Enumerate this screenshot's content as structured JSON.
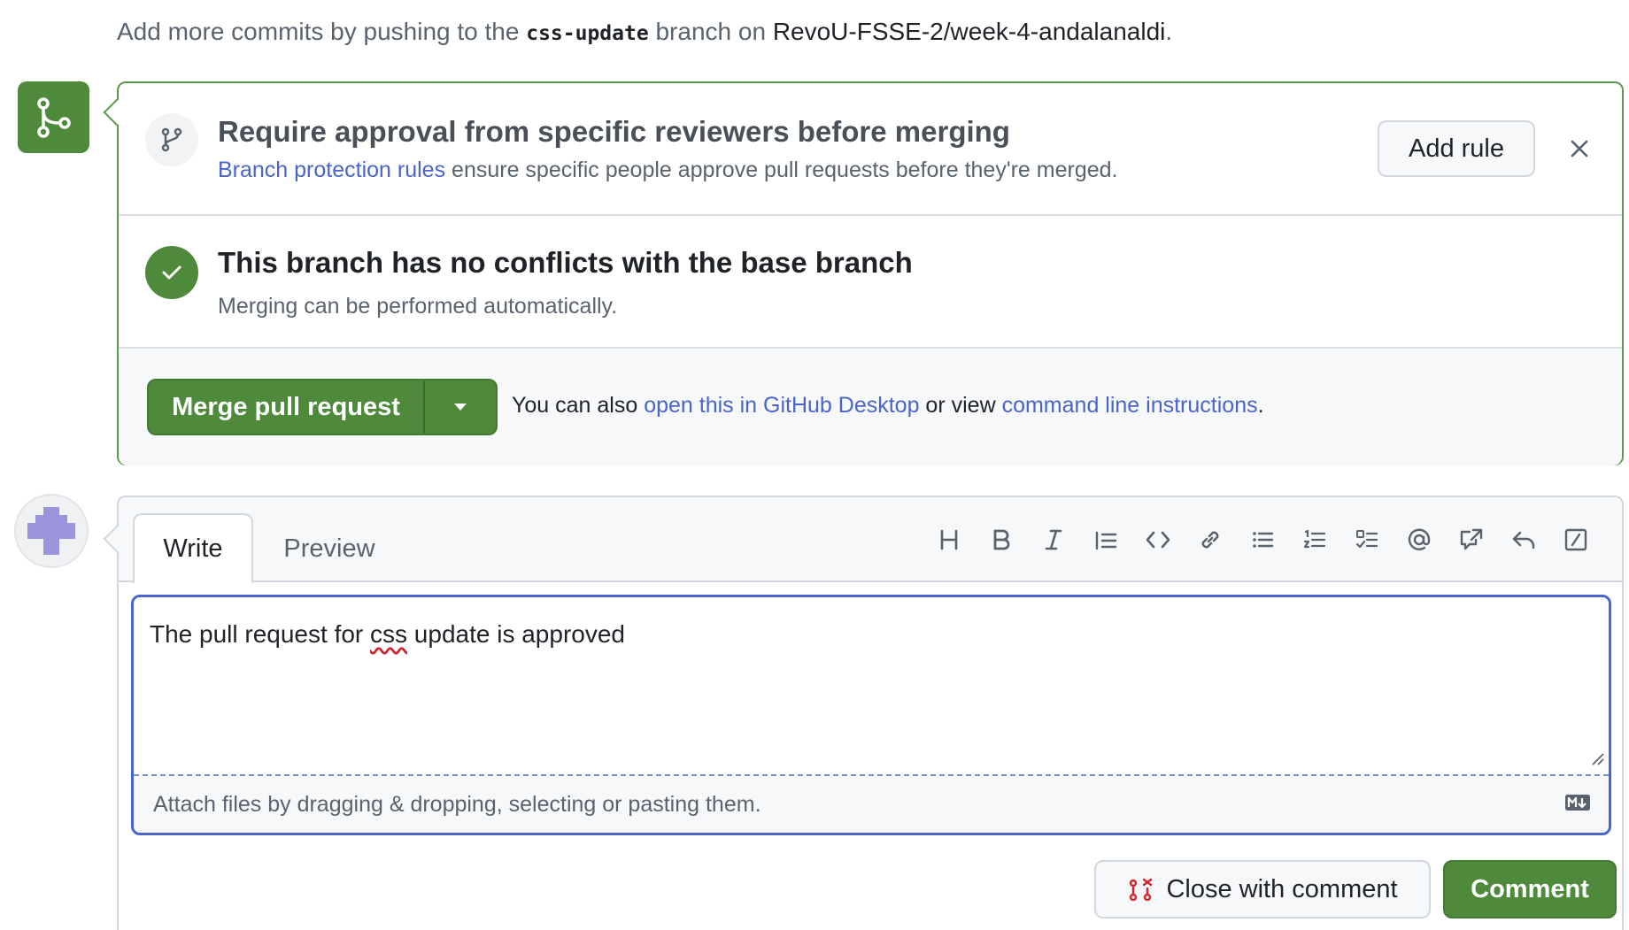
{
  "hint": {
    "prefix": "Add more commits by pushing to the ",
    "branch": "css-update",
    "middle": " branch on ",
    "repo": "RevoU-FSSE-2/week-4-andalanaldi",
    "suffix": "."
  },
  "rule_section": {
    "title": "Require approval from specific reviewers before merging",
    "link": "Branch protection rules",
    "subtitle_rest": " ensure specific people approve pull requests before they're merged.",
    "add_rule_label": "Add rule"
  },
  "conflict_section": {
    "title": "This branch has no conflicts with the base branch",
    "subtitle": "Merging can be performed automatically."
  },
  "merge_section": {
    "button_label": "Merge pull request",
    "text_prefix": "You can also ",
    "desktop_link": "open this in GitHub Desktop",
    "text_middle": " or view ",
    "cli_link": "command line instructions",
    "text_suffix": "."
  },
  "comment": {
    "tabs": {
      "write": "Write",
      "preview": "Preview"
    },
    "toolbar_icons": [
      "heading-icon",
      "bold-icon",
      "italic-icon",
      "quote-icon",
      "code-icon",
      "link-icon",
      "unordered-list-icon",
      "ordered-list-icon",
      "task-list-icon",
      "mention-icon",
      "reference-icon",
      "reply-icon",
      "slash-command-icon"
    ],
    "text_before": "The pull request for ",
    "text_misspelled": "css",
    "text_after": " update is approved",
    "attach_text": "Attach files by dragging & dropping, selecting or pasting them.",
    "close_label": "Close with comment",
    "comment_label": "Comment"
  },
  "colors": {
    "success": "#4f8a3c",
    "link": "#4a64c8",
    "focus_border": "#4a64c8",
    "avatar": "#9b96dc"
  }
}
